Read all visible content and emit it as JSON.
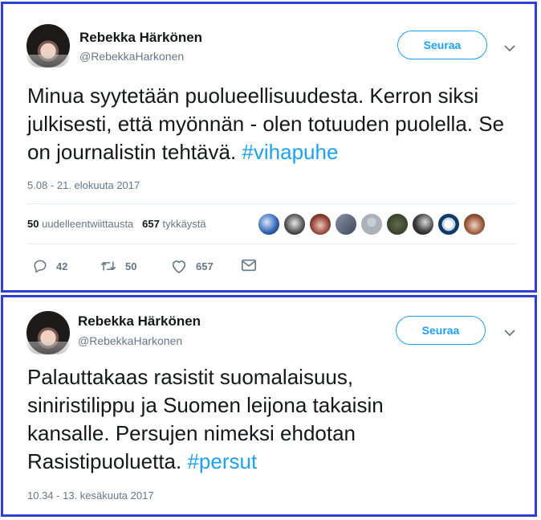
{
  "tweets": [
    {
      "name": "Rebekka Härkönen",
      "handle": "@RebekkaHarkonen",
      "follow_label": "Seuraa",
      "text": "Minua syytetään puolueellisuudesta. Kerron siksi julkisesti, että myönnän - olen totuuden puolella. Se on journalistin tehtävä.",
      "hashtag": "#vihapuhe",
      "date": "5.08 - 21. elokuuta 2017",
      "retweets_count": "50",
      "retweets_label": "uudelleentwiittausta",
      "likes_count": "657",
      "likes_label": "tykkäystä",
      "actions": {
        "replies": "42",
        "retweets": "50",
        "likes": "657"
      }
    },
    {
      "name": "Rebekka Härkönen",
      "handle": "@RebekkaHarkonen",
      "follow_label": "Seuraa",
      "text": "Palauttakaas rasistit suomalaisuus, siniristilippu ja Suomen leijona takaisin kansalle. Persujen nimeksi ehdotan Rasistipuoluetta.",
      "hashtag": "#persut",
      "date": "10.34 - 13. kesäkuuta 2017"
    }
  ],
  "colors": {
    "accent": "#1da1f2",
    "frame": "#2f3fd0",
    "muted": "#657786",
    "text": "#14171a"
  }
}
